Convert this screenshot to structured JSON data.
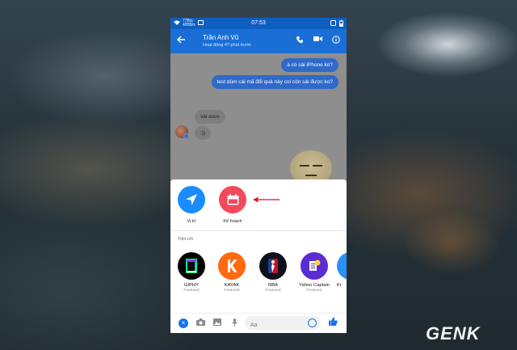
{
  "status_bar": {
    "speed_top": "77B/s",
    "speed_bottom": "405B/s",
    "time": "07:53"
  },
  "header": {
    "contact_name": "Trần Anh Vũ",
    "activity": "Hoạt động 47 phút trước",
    "back_icon": "arrow-left-icon",
    "call_icon": "phone-icon",
    "video_icon": "video-camera-icon",
    "info_icon": "info-icon"
  },
  "messages": [
    {
      "side": "out",
      "text": "à có sài iPhone ko?"
    },
    {
      "side": "out",
      "text": "test dùm cái mã đổi quà này coi còn sài được ko?"
    },
    {
      "side": "in",
      "text": "sài asus"
    },
    {
      "side": "in",
      "text": ":))"
    }
  ],
  "actions": [
    {
      "label": "Vị trí",
      "icon": "location-arrow-icon",
      "color": "#1a8cff"
    },
    {
      "label": "Kế hoạch",
      "icon": "calendar-icon",
      "color": "#f24a5a"
    }
  ],
  "extensions_section": {
    "title": "Tiện ích",
    "items": [
      {
        "name": "GIPHY",
        "tag": "Featured"
      },
      {
        "name": "KAYAK",
        "tag": "Featured"
      },
      {
        "name": "NBA",
        "tag": "Featured"
      },
      {
        "name": "Yahoo Captain",
        "tag": "Featured"
      },
      {
        "name": "Ki",
        "tag": ""
      }
    ]
  },
  "composer": {
    "placeholder": "Aa"
  },
  "watermark": "GENK",
  "colors": {
    "messenger_blue": "#1a6fd6",
    "annotation_red": "#d0142c"
  }
}
